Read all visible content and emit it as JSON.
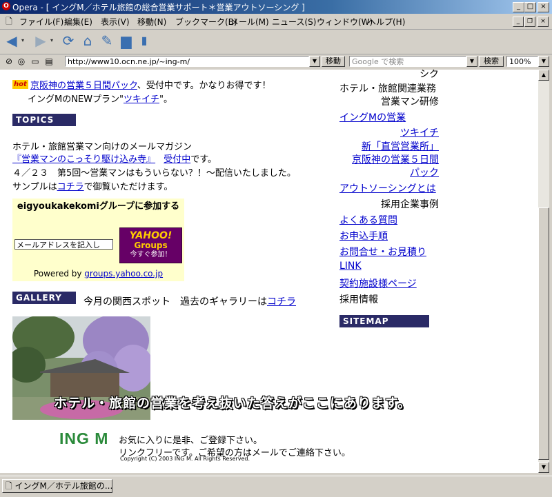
{
  "window": {
    "title": "Opera - [ イングM／ホテル旅館の総合営業サポート＊営業アウトソーシング ]",
    "app_icon_glyph": "O"
  },
  "menu": [
    "ファイル(F)",
    "編集(E)",
    "表示(V)",
    "移動(N)",
    "ブックマーク(B)",
    "メール(M)",
    "ニュース(S)",
    "ウィンドウ(W)",
    "ヘルプ(H)"
  ],
  "address": {
    "url": "http://www10.ocn.ne.jp/~ing-m/",
    "go_label": "移動",
    "search_placeholder": "Google で検索",
    "search_button": "検索",
    "zoom": "100%"
  },
  "page": {
    "hot_badge": "hot",
    "hot_link": "京阪神の営業５日間パック",
    "hot_text": "、受付中です。かなりお得です！",
    "newplan_prefix": "イングMのNEWプラン\"",
    "newplan_link": "ツキイチ",
    "newplan_suffix": "\"。",
    "topics_header": "TOPICS",
    "topics_line1": "ホテル・旅館営業マン向けのメールマガジン",
    "topics_magazine_link": "『営業マンのこっそり駆け込み寺』",
    "topics_accepting_link": "受付中",
    "topics_accepting_suffix": "です。",
    "topics_line3": "４／２３　第5回～営業マンはもういらない？！～配信いたしました。",
    "topics_sample_prefix": "サンプルは",
    "topics_sample_link": "コチラ",
    "topics_sample_suffix": "で御覧いただけます。",
    "group_title": "eigyoukakekomiグループに参加する",
    "group_email_placeholder": "メールアドレスを記入し",
    "yahoo_line1": "YAHOO!",
    "yahoo_line2": "Groups",
    "yahoo_line3": "今すぐ参加！",
    "group_powered_prefix": "Powered by ",
    "group_powered_link": "groups.yahoo.co.jp",
    "gallery_header": "GALLERY",
    "gallery_text": "今月の関西スポット　過去のギャラリーは",
    "gallery_link": "コチラ",
    "banner_text": "ホテル・旅館の営業を考え抜いた答えがここにあります。",
    "footer_logo": "ING M",
    "footer_line1": "お気に入りに是非、ご登録下さい。",
    "footer_line2": "リンクフリーです。ご希望の方はメールでご連絡下さい。",
    "copyright": "Copyright (C) 2003 ING M. All Rights Reserved."
  },
  "sidebar": {
    "cut_top": "シク",
    "items": [
      {
        "label": "ホテル・旅館関連業務",
        "link": false
      },
      {
        "label": "営業マン研修",
        "link": false
      },
      {
        "label": "イングMの営業",
        "link": true
      },
      {
        "label": "ツキイチ",
        "link": true
      },
      {
        "label": "新「直営営業所」",
        "link": true
      },
      {
        "label": "京阪神の営業５日間",
        "link": true
      },
      {
        "label": "パック",
        "link": true
      },
      {
        "label": "アウトソーシングとは",
        "link": true
      },
      {
        "label": "採用企業事例",
        "link": false
      },
      {
        "label": "よくある質問",
        "link": true
      },
      {
        "label": "お申込手順",
        "link": true
      },
      {
        "label": "お問合せ・お見積り",
        "link": true
      },
      {
        "label": "LINK",
        "link": true
      },
      {
        "label": "契約施設様ページ",
        "link": true
      },
      {
        "label": "採用情報",
        "link": false
      }
    ],
    "sitemap_header": "SITEMAP"
  },
  "statusbar": {
    "tab_label": "イングM／ホテル旅館の..."
  },
  "colors": {
    "section_header_bg": "#2a2a66",
    "link": "#0000cc",
    "group_box_bg": "#ffffcc",
    "yahoo_bg": "#660066",
    "yahoo_text": "#ffcc00",
    "logo_green": "#2a8a3a"
  }
}
